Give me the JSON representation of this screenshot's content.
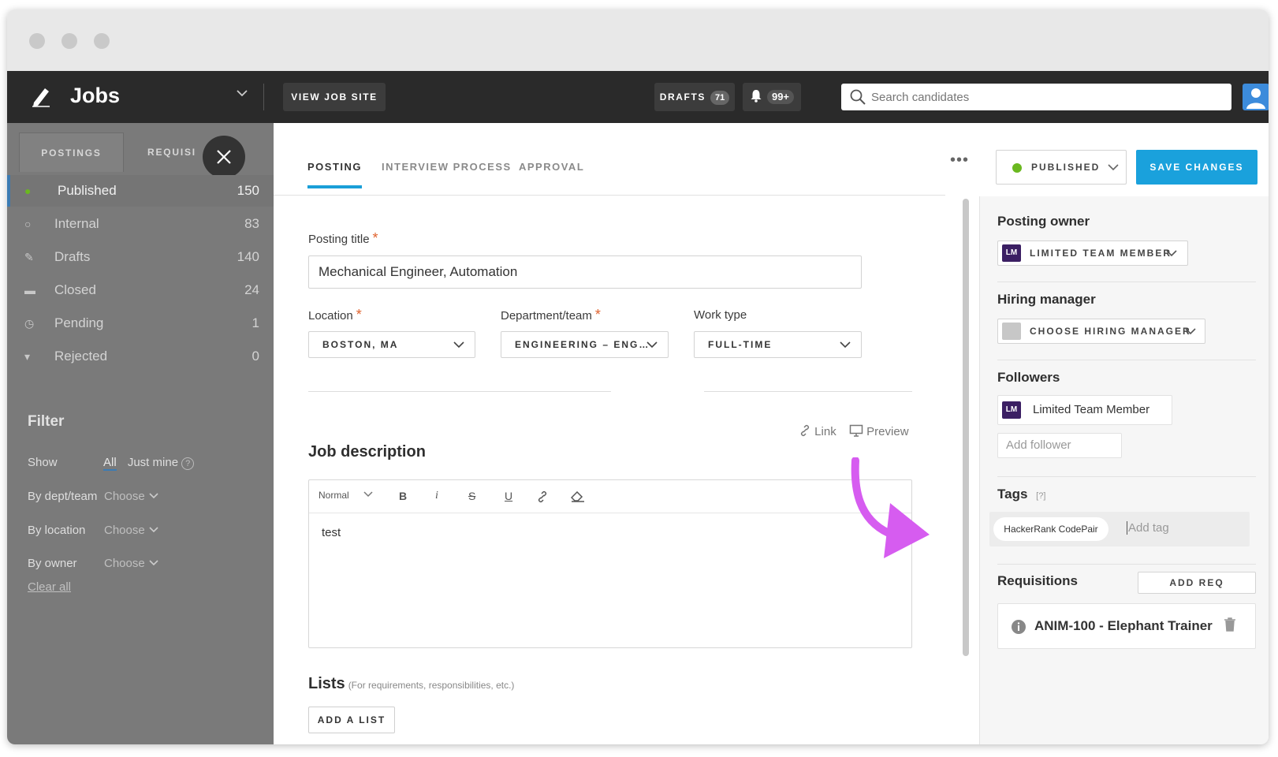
{
  "header": {
    "app_title": "Jobs",
    "view_job_site": "VIEW JOB SITE",
    "drafts_label": "DRAFTS",
    "drafts_count": "71",
    "notifications_count": "99+",
    "search_placeholder": "Search candidates"
  },
  "sidebar": {
    "tabs": [
      "POSTINGS",
      "REQUISI"
    ],
    "statuses": [
      {
        "label": "Published",
        "count": "150",
        "icon": "green-dot-icon"
      },
      {
        "label": "Internal",
        "count": "83",
        "icon": "circle-icon"
      },
      {
        "label": "Drafts",
        "count": "140",
        "icon": "pencil-icon"
      },
      {
        "label": "Closed",
        "count": "24",
        "icon": "square-icon"
      },
      {
        "label": "Pending",
        "count": "1",
        "icon": "clock-icon"
      },
      {
        "label": "Rejected",
        "count": "0",
        "icon": "thumbs-down-icon"
      }
    ],
    "filter": {
      "heading": "Filter",
      "show_label": "Show",
      "show_all": "All",
      "show_mine": "Just mine",
      "help": "?",
      "by_dept_label": "By dept/team",
      "by_location_label": "By location",
      "by_owner_label": "By owner",
      "choose": "Choose",
      "clear_all": "Clear all"
    }
  },
  "main": {
    "tabs": [
      "POSTING",
      "INTERVIEW PROCESS",
      "APPROVAL"
    ],
    "posting_title_label": "Posting title",
    "posting_title_value": "Mechanical Engineer, Automation",
    "location_label": "Location",
    "location_value": "BOSTON, MA",
    "department_label": "Department/team",
    "department_value": "ENGINEERING – ENG…",
    "work_type_label": "Work type",
    "work_type_value": "FULL-TIME",
    "required_mark": "*",
    "link_label": "Link",
    "preview_label": "Preview",
    "job_description_heading": "Job description",
    "editor_format": "Normal",
    "editor_body": "test",
    "lists_heading": "Lists",
    "lists_sub": "(For requirements, responsibilities, etc.)",
    "add_list": "ADD A LIST"
  },
  "actions": {
    "more": "•••",
    "status": "PUBLISHED",
    "save": "SAVE CHANGES"
  },
  "panel": {
    "posting_owner_heading": "Posting owner",
    "owner_initials": "LM",
    "owner_value": "LIMITED TEAM MEMBER",
    "hiring_manager_heading": "Hiring manager",
    "hiring_manager_value": "CHOOSE HIRING MANAGER",
    "followers_heading": "Followers",
    "follower_name": "Limited Team Member",
    "add_follower": "Add follower",
    "tags_heading": "Tags",
    "tags_help": "[?]",
    "tag_chip": "HackerRank CodePair",
    "add_tag": "Add tag",
    "requisitions_heading": "Requisitions",
    "add_req": "ADD REQ",
    "requisition": "ANIM-100 - Elephant Trainer"
  },
  "colors": {
    "accent": "#1aa1dc",
    "published": "#6ab81f",
    "annotation_arrow": "#d65cf0",
    "owner_avatar": "#3b1f63"
  }
}
